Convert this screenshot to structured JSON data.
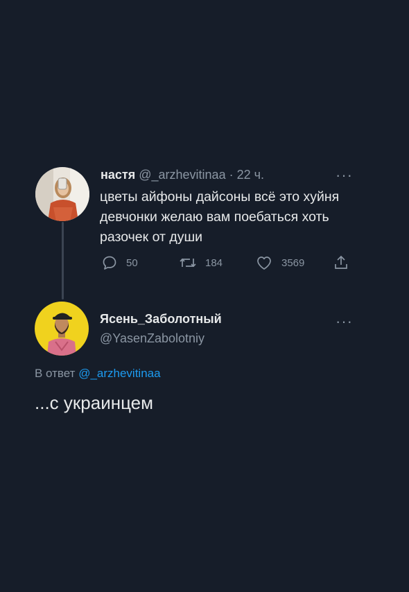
{
  "parent_tweet": {
    "display_name": "настя",
    "handle": "@_arzhevitinaa",
    "separator": "·",
    "time": "22 ч.",
    "more_label": "···",
    "text": "цветы айфоны дайсоны всё это хуйня девчонки желаю вам поебаться хоть разочек от души",
    "actions": {
      "replies": "50",
      "retweets": "184",
      "likes": "3569"
    },
    "icons": [
      "reply-icon",
      "retweet-icon",
      "like-icon",
      "share-icon"
    ]
  },
  "reply_tweet": {
    "display_name": "Ясень_Заболотный",
    "handle": "@YasenZabolotniy",
    "more_label": "···",
    "reply_to_prefix": "В ответ",
    "reply_to_handle": "@_arzhevitinaa",
    "text": "...с украинцем"
  },
  "colors": {
    "background": "#161d29",
    "text": "#e7e9ea",
    "muted": "#8b96a3",
    "accent": "#1d9bf0"
  }
}
